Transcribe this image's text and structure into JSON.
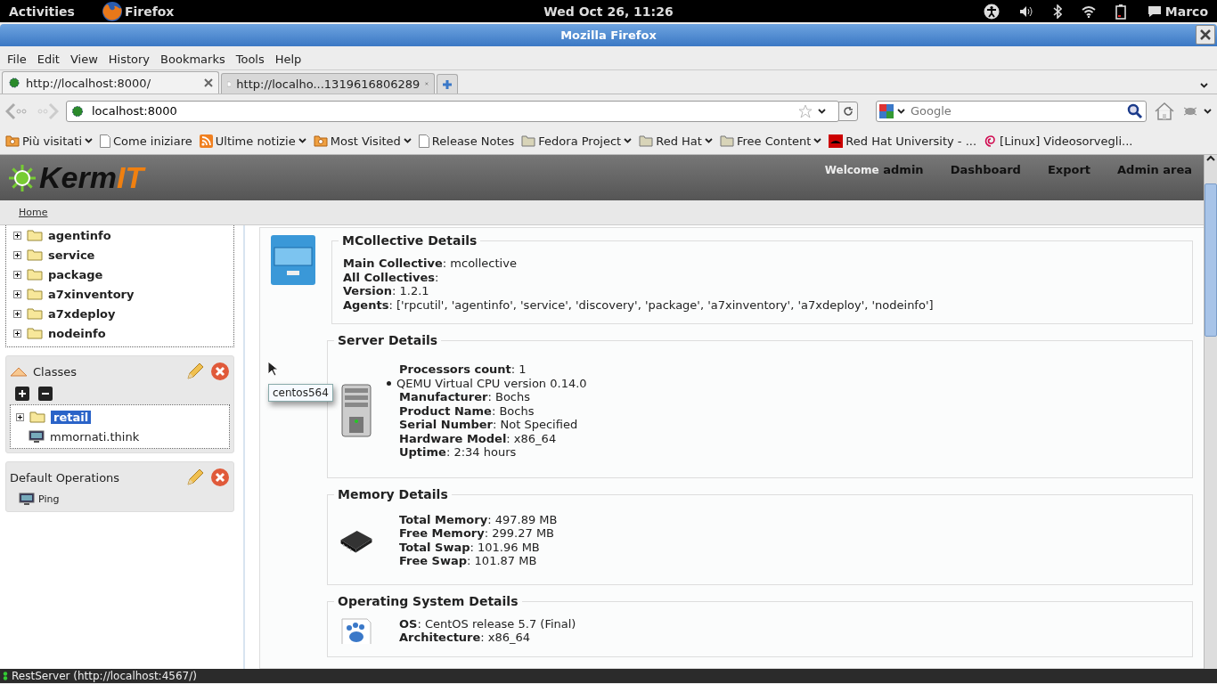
{
  "top_bar": {
    "activities": "Activities",
    "app": "Firefox",
    "clock": "Wed Oct 26, 11:26",
    "user": "Marco"
  },
  "window": {
    "title": "Mozilla Firefox"
  },
  "menu": [
    "File",
    "Edit",
    "View",
    "History",
    "Bookmarks",
    "Tools",
    "Help"
  ],
  "tabs": [
    {
      "label": "http://localhost:8000/",
      "selected": true,
      "kind": "site"
    },
    {
      "label": "http://localho...1319616806289",
      "selected": false,
      "kind": "page"
    }
  ],
  "address": {
    "value": "localhost:8000"
  },
  "search": {
    "placeholder": "Google"
  },
  "bookmarks": [
    {
      "label": "Più visitati",
      "kind": "smart",
      "menu": true
    },
    {
      "label": "Come iniziare",
      "kind": "page",
      "menu": false
    },
    {
      "label": "Ultime notizie",
      "kind": "rss",
      "menu": true
    },
    {
      "label": "Most Visited",
      "kind": "smart",
      "menu": true
    },
    {
      "label": "Release Notes",
      "kind": "page",
      "menu": false
    },
    {
      "label": "Fedora Project",
      "kind": "folder",
      "menu": true
    },
    {
      "label": "Red Hat",
      "kind": "folder",
      "menu": true
    },
    {
      "label": "Free Content",
      "kind": "folder",
      "menu": true
    },
    {
      "label": "Red Hat University - ...",
      "kind": "redhat",
      "menu": false
    },
    {
      "label": "[Linux] Videosorvegli...",
      "kind": "debian",
      "menu": false
    }
  ],
  "header": {
    "logo_main": "Kerm",
    "logo_accent": "IT",
    "welcome": "Welcome",
    "user": "admin",
    "links": [
      "Dashboard",
      "Export",
      "Admin area"
    ]
  },
  "breadcrumb": "Home",
  "agents_tree": [
    "agentinfo",
    "service",
    "package",
    "a7xinventory",
    "a7xdeploy",
    "nodeinfo"
  ],
  "classes": {
    "title": "Classes",
    "tree": [
      {
        "label": "retail",
        "kind": "folder",
        "selected": true
      },
      {
        "label": "mmornati.think",
        "kind": "computer",
        "selected": false
      }
    ]
  },
  "operations": {
    "title": "Default Operations",
    "items": [
      "Ping"
    ]
  },
  "tooltip": "centos564",
  "sections": [
    {
      "title": "MCollective Details",
      "kind": "mcollective",
      "rows": [
        {
          "kind": "field",
          "text": "**Main Collective**: mcollective"
        },
        {
          "kind": "field",
          "text": "**All Collectives**:"
        },
        {
          "kind": "field",
          "text": "**Version**: 1.2.1"
        },
        {
          "kind": "field",
          "text": "**Agents**: ['rpcutil', 'agentinfo', 'service', 'discovery', 'package', 'a7xinventory', 'a7xdeploy', 'nodeinfo']"
        }
      ]
    },
    {
      "title": "Server Details",
      "kind": "server",
      "rows": [
        {
          "kind": "field",
          "text": "**Processors count**: 1"
        },
        {
          "kind": "bullet",
          "text": "QEMU Virtual CPU version 0.14.0"
        },
        {
          "kind": "field",
          "text": "**Manufacturer**: Bochs"
        },
        {
          "kind": "field",
          "text": "**Product Name**: Bochs"
        },
        {
          "kind": "field",
          "text": "**Serial Number**: Not Specified"
        },
        {
          "kind": "field",
          "text": "**Hardware Model**: x86_64"
        },
        {
          "kind": "field",
          "text": "**Uptime**: 2:34 hours"
        }
      ]
    },
    {
      "title": "Memory Details",
      "kind": "memory",
      "rows": [
        {
          "kind": "field",
          "text": "**Total Memory**: 497.89 MB"
        },
        {
          "kind": "field",
          "text": "**Free Memory**: 299.27 MB"
        },
        {
          "kind": "field",
          "text": "**Total Swap**: 101.96 MB"
        },
        {
          "kind": "field",
          "text": "**Free Swap**: 101.87 MB"
        }
      ]
    },
    {
      "title": "Operating System Details",
      "kind": "os",
      "rows": [
        {
          "kind": "field",
          "text": "**OS**: CentOS release 5.7 (Final)"
        },
        {
          "kind": "field",
          "text": "**Architecture**: x86_64"
        }
      ]
    }
  ],
  "status_bar": "RestServer (http://localhost:4567/)"
}
